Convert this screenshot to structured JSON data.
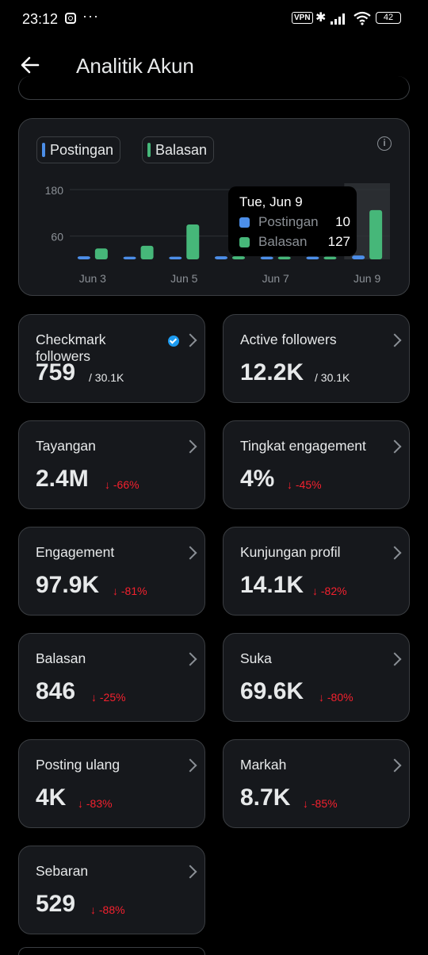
{
  "status_bar": {
    "time": "23:12",
    "dots": "···",
    "vpn": "VPN",
    "battery": "42",
    "icons": [
      "instagram-icon",
      "bluetooth-icon",
      "signal-icon",
      "wifi-icon",
      "battery-icon"
    ]
  },
  "header": {
    "title": "Analitik Akun",
    "back_icon": "arrow-left-icon"
  },
  "colors": {
    "postingan": "#4c8ee8",
    "balasan": "#46b779",
    "negative": "#f4212e",
    "verified": "#1d9bf0"
  },
  "chart": {
    "legend": [
      {
        "label": "Postingan",
        "color": "#4c8ee8"
      },
      {
        "label": "Balasan",
        "color": "#46b779"
      }
    ],
    "tooltip": {
      "title": "Tue, Jun 9",
      "rows": [
        {
          "label": "Postingan",
          "value": "10",
          "color": "#4c8ee8"
        },
        {
          "label": "Balasan",
          "value": "127",
          "color": "#46b779"
        }
      ]
    }
  },
  "chart_data": {
    "type": "bar",
    "categories": [
      "Jun 3",
      "Jun 4",
      "Jun 5",
      "Jun 6",
      "Jun 7",
      "Jun 8",
      "Jun 9"
    ],
    "x_tick_labels": [
      "Jun 3",
      "Jun 5",
      "Jun 7",
      "Jun 9"
    ],
    "y_tick_labels": [
      "180",
      "60"
    ],
    "y_ticks": [
      180,
      60
    ],
    "ylim": [
      0,
      180
    ],
    "grid": true,
    "highlighted_category": "Jun 9",
    "series": [
      {
        "name": "Postingan",
        "values": [
          8,
          7,
          7,
          8,
          7,
          7,
          10
        ]
      },
      {
        "name": "Balasan",
        "values": [
          28,
          35,
          90,
          8,
          7,
          7,
          127
        ]
      }
    ]
  },
  "stats": [
    {
      "label": "Checkmark followers",
      "value": "759",
      "sub": "/ 30.1K",
      "verified": true
    },
    {
      "label": "Active followers",
      "value": "12.2K",
      "sub": "/ 30.1K"
    },
    {
      "label": "Tayangan",
      "value": "2.4M",
      "delta": "↓ -66%"
    },
    {
      "label": "Tingkat engagement",
      "value": "4%",
      "delta": "↓ -45%"
    },
    {
      "label": "Engagement",
      "value": "97.9K",
      "delta": "↓ -81%"
    },
    {
      "label": "Kunjungan profil",
      "value": "14.1K",
      "delta": "↓ -82%"
    },
    {
      "label": "Balasan",
      "value": "846",
      "delta": "↓ -25%"
    },
    {
      "label": "Suka",
      "value": "69.6K",
      "delta": "↓ -80%"
    },
    {
      "label": "Posting ulang",
      "value": "4K",
      "delta": "↓ -83%"
    },
    {
      "label": "Markah",
      "value": "8.7K",
      "delta": "↓ -85%"
    },
    {
      "label": "Sebaran",
      "value": "529",
      "delta": "↓ -88%"
    }
  ]
}
